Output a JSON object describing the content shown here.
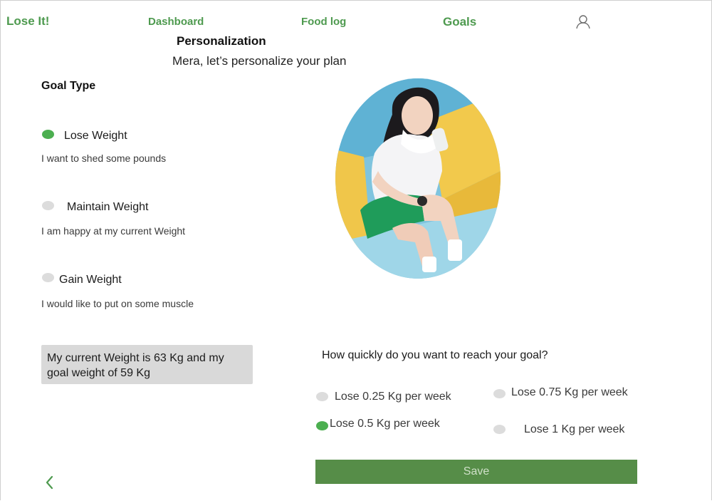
{
  "header": {
    "logo": "Lose It!",
    "nav": {
      "dashboard": "Dashboard",
      "food_log": "Food log",
      "goals": "Goals"
    },
    "user_icon": "user-icon"
  },
  "page": {
    "title": "Personalization",
    "subtitle": "Mera, let’s  personalize your plan"
  },
  "goal_type": {
    "heading": "Goal Type",
    "options": [
      {
        "label": "Lose Weight",
        "description": "I want to shed some pounds",
        "selected": true
      },
      {
        "label": "Maintain Weight",
        "description": "I am happy at my current Weight",
        "selected": false
      },
      {
        "label": "Gain Weight",
        "description": "I would like to put on some muscle",
        "selected": false
      }
    ]
  },
  "summary": {
    "line1": "My current Weight is 63 Kg and my",
    "line2": "goal weight of 59 Kg"
  },
  "rate": {
    "question": "How quickly do you want to reach your goal?",
    "options": [
      {
        "label": "Lose 0.25 Kg per week",
        "selected": false
      },
      {
        "label": "Lose 0.75 Kg per week",
        "selected": false
      },
      {
        "label": "Lose 0.5 Kg per week",
        "selected": true
      },
      {
        "label": "Lose 1 Kg per week",
        "selected": false
      }
    ]
  },
  "save_label": "Save",
  "back_icon": "chevron-left-icon",
  "colors": {
    "brand_green": "#4e9a4f",
    "selected_dot": "#4caf50",
    "unselected_dot": "#dcdcdc",
    "save_button": "#568d48",
    "summary_bg": "#d9d9d9"
  }
}
